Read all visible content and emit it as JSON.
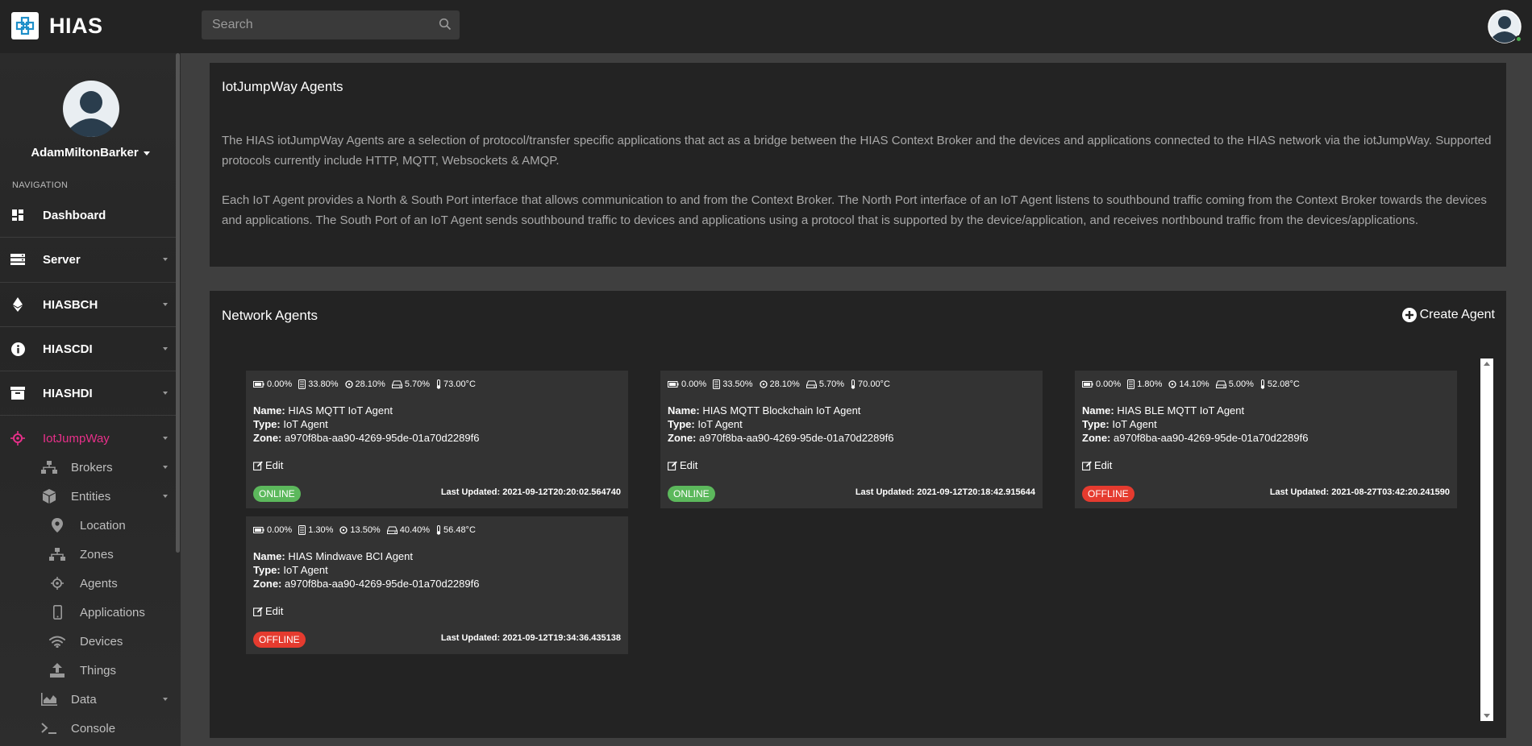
{
  "app": {
    "name": "HIAS"
  },
  "search": {
    "placeholder": "Search"
  },
  "user": {
    "name": "AdamMiltonBarker"
  },
  "sidebar": {
    "heading": "NAVIGATION",
    "items": [
      {
        "label": "Dashboard",
        "icon": "dashboard-icon"
      },
      {
        "label": "Server",
        "icon": "server-icon"
      },
      {
        "label": "HIASBCH",
        "icon": "ethereum-icon"
      },
      {
        "label": "HIASCDI",
        "icon": "info-icon"
      },
      {
        "label": "HIASHDI",
        "icon": "archive-icon"
      },
      {
        "label": "IotJumpWay",
        "icon": "iot-chip-icon"
      }
    ],
    "sub_items": [
      {
        "label": "Brokers",
        "icon": "network-icon"
      },
      {
        "label": "Entities",
        "icon": "cube-icon"
      },
      {
        "label": "Location",
        "icon": "map-marker-icon"
      },
      {
        "label": "Zones",
        "icon": "network-icon"
      },
      {
        "label": "Agents",
        "icon": "agent-icon"
      },
      {
        "label": "Applications",
        "icon": "mobile-icon"
      },
      {
        "label": "Devices",
        "icon": "wifi-icon"
      },
      {
        "label": "Things",
        "icon": "upload-icon"
      },
      {
        "label": "Data",
        "icon": "area-chart-icon"
      },
      {
        "label": "Console",
        "icon": "terminal-icon"
      }
    ],
    "active_color": "#e8308a"
  },
  "info_panel": {
    "title": "IotJumpWay Agents",
    "paragraph1": "The HIAS iotJumpWay Agents are a selection of protocol/transfer specific applications that act as a bridge between the HIAS Context Broker and the devices and applications connected to the HIAS network via the iotJumpWay. Supported protocols currently include HTTP, MQTT, Websockets & AMQP.",
    "paragraph2": "Each IoT Agent provides a North & South Port interface that allows communication to and from the Context Broker. The North Port interface of an IoT Agent listens to southbound traffic coming from the Context Broker towards the devices and applications. The South Port of an IoT Agent sends southbound traffic to devices and applications using a protocol that is supported by the device/application, and receives northbound traffic from the devices/applications."
  },
  "agents_panel": {
    "title": "Network Agents",
    "create_label": "Create Agent",
    "labels": {
      "name": "Name:",
      "type": "Type:",
      "zone": "Zone:",
      "edit": "Edit"
    },
    "cards": [
      {
        "battery": "0.00%",
        "cpu": "33.80%",
        "memory": "28.10%",
        "hdd": "5.70%",
        "temperature": "73.00°C",
        "name": "HIAS MQTT IoT Agent",
        "type": "IoT Agent",
        "zone": "a970f8ba-aa90-4269-95de-01a70d2289f6",
        "status": "ONLINE",
        "updated": "Last Updated: 2021-09-12T20:20:02.564740"
      },
      {
        "battery": "0.00%",
        "cpu": "33.50%",
        "memory": "28.10%",
        "hdd": "5.70%",
        "temperature": "70.00°C",
        "name": "HIAS MQTT Blockchain IoT Agent",
        "type": "IoT Agent",
        "zone": "a970f8ba-aa90-4269-95de-01a70d2289f6",
        "status": "ONLINE",
        "updated": "Last Updated: 2021-09-12T20:18:42.915644"
      },
      {
        "battery": "0.00%",
        "cpu": "1.80%",
        "memory": "14.10%",
        "hdd": "5.00%",
        "temperature": "52.08°C",
        "name": "HIAS BLE MQTT IoT Agent",
        "type": "IoT Agent",
        "zone": "a970f8ba-aa90-4269-95de-01a70d2289f6",
        "status": "OFFLINE",
        "updated": "Last Updated: 2021-08-27T03:42:20.241590"
      },
      {
        "battery": "0.00%",
        "cpu": "1.30%",
        "memory": "13.50%",
        "hdd": "40.40%",
        "temperature": "56.48°C",
        "name": "HIAS Mindwave BCI Agent",
        "type": "IoT Agent",
        "zone": "a970f8ba-aa90-4269-95de-01a70d2289f6",
        "status": "OFFLINE",
        "updated": "Last Updated: 2021-09-12T19:34:36.435138"
      }
    ]
  },
  "colors": {
    "online": "#5cb85c",
    "offline": "#e53b2f",
    "panel": "#232323",
    "card": "#333333"
  }
}
